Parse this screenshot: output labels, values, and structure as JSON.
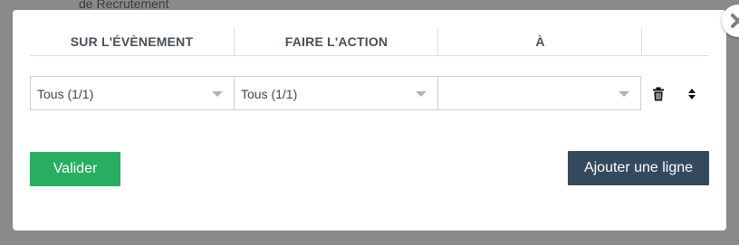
{
  "background_text": "de Recrutement",
  "table": {
    "headers": [
      "SUR L'ÉVÈNEMENT",
      "FAIRE L'ACTION",
      "À",
      ""
    ]
  },
  "row": {
    "event_select": "Tous (1/1)",
    "action_select": "Tous (1/1)",
    "target_select": ""
  },
  "icons": {
    "close": "close-icon",
    "delete": "trash-icon",
    "reorder": "sort-icon",
    "dropdown": "chevron-down-icon"
  },
  "buttons": {
    "validate": "Valider",
    "add_line": "Ajouter une ligne"
  },
  "colors": {
    "validate_bg": "#27ae60",
    "add_line_bg": "#34495e",
    "overlay": "#8a8a8a"
  }
}
